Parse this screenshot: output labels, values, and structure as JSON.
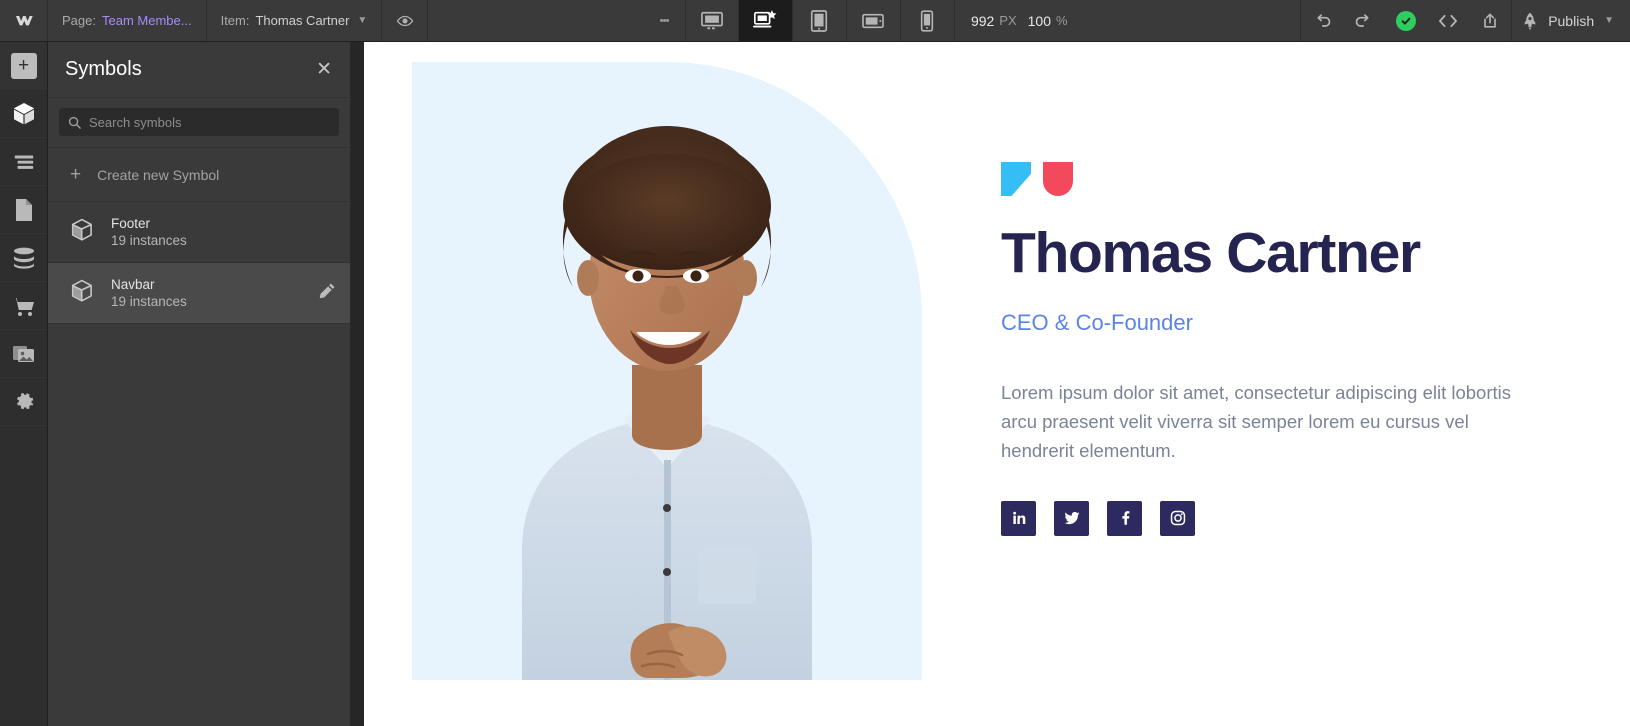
{
  "topbar": {
    "logo_icon": "webflow-logo-icon",
    "page_label": "Page:",
    "page_value": "Team Membe...",
    "item_label": "Item:",
    "item_value": "Thomas Cartner",
    "item_chevron_icon": "chevron-down-icon",
    "preview_icon": "eye-preview-icon",
    "more_icon": "more-vertical-icon",
    "breakpoints": [
      {
        "name": "desktop-breakpoint",
        "icon": "monitor-icon",
        "active": false
      },
      {
        "name": "base-breakpoint",
        "icon": "laptop-star-icon",
        "active": true
      },
      {
        "name": "tablet-breakpoint",
        "icon": "tablet-icon",
        "active": false
      },
      {
        "name": "mobile-landscape-breakpoint",
        "icon": "mobile-landscape-icon",
        "active": false
      },
      {
        "name": "mobile-portrait-breakpoint",
        "icon": "mobile-icon",
        "active": false
      }
    ],
    "canvas_width": "992",
    "canvas_width_unit": "PX",
    "zoom_value": "100",
    "zoom_unit": "%",
    "undo_icon": "undo-icon",
    "redo_icon": "redo-icon",
    "saved_icon": "checkmark-saved-icon",
    "code_icon": "code-brackets-icon",
    "export_icon": "export-share-icon",
    "rocket_icon": "rocket-icon",
    "publish_label": "Publish",
    "publish_chevron_icon": "chevron-down-icon"
  },
  "rail": {
    "items": [
      {
        "name": "add-elements-button",
        "icon": "plus-icon",
        "active": false,
        "boxed": true
      },
      {
        "name": "symbols-panel-button",
        "icon": "cube-symbol-icon",
        "active": true,
        "boxed": false
      },
      {
        "name": "navigator-panel-button",
        "icon": "navigator-lines-icon",
        "active": false,
        "boxed": false
      },
      {
        "name": "pages-panel-button",
        "icon": "page-document-icon",
        "active": false,
        "boxed": false
      },
      {
        "name": "cms-panel-button",
        "icon": "database-icon",
        "active": false,
        "boxed": false
      },
      {
        "name": "ecommerce-panel-button",
        "icon": "shopping-cart-icon",
        "active": false,
        "boxed": false
      },
      {
        "name": "assets-panel-button",
        "icon": "image-stack-icon",
        "active": false,
        "boxed": false
      },
      {
        "name": "settings-panel-button",
        "icon": "gear-icon",
        "active": false,
        "boxed": false
      }
    ]
  },
  "panel": {
    "title": "Symbols",
    "close_icon": "close-x-icon",
    "search_placeholder": "Search symbols",
    "search_value": "",
    "search_icon": "search-icon",
    "create_label": "Create new Symbol",
    "create_icon": "plus-icon",
    "symbols": [
      {
        "name": "Footer",
        "count": "19 instances",
        "icon": "cube-symbol-icon",
        "selected": false,
        "edit_icon": null
      },
      {
        "name": "Navbar",
        "count": "19 instances",
        "icon": "cube-symbol-icon",
        "selected": true,
        "edit_icon": "pencil-edit-icon"
      }
    ]
  },
  "canvas": {
    "photo_background_color": "#e8f4fd",
    "photo_alt": "portrait-of-smiling-man-in-light-blue-shirt",
    "decorations": [
      {
        "name": "blue-triangle-decoration",
        "color": "#35bdf5"
      },
      {
        "name": "red-shield-decoration",
        "color": "#f24a5c"
      }
    ],
    "person_name": "Thomas Cartner",
    "person_role": "CEO & Co-Founder",
    "person_bio": "Lorem ipsum dolor sit amet, consectetur adipiscing elit lobortis arcu praesent velit viverra sit semper lorem eu cursus vel hendrerit elementum.",
    "name_color": "#252350",
    "role_color": "#5b84e8",
    "bio_color": "#7b8396",
    "socials": [
      {
        "name": "linkedin-link",
        "icon": "linkedin-icon"
      },
      {
        "name": "twitter-link",
        "icon": "twitter-icon"
      },
      {
        "name": "facebook-link",
        "icon": "facebook-icon"
      },
      {
        "name": "instagram-link",
        "icon": "instagram-icon"
      }
    ],
    "social_button_color": "#2c2a5e"
  }
}
